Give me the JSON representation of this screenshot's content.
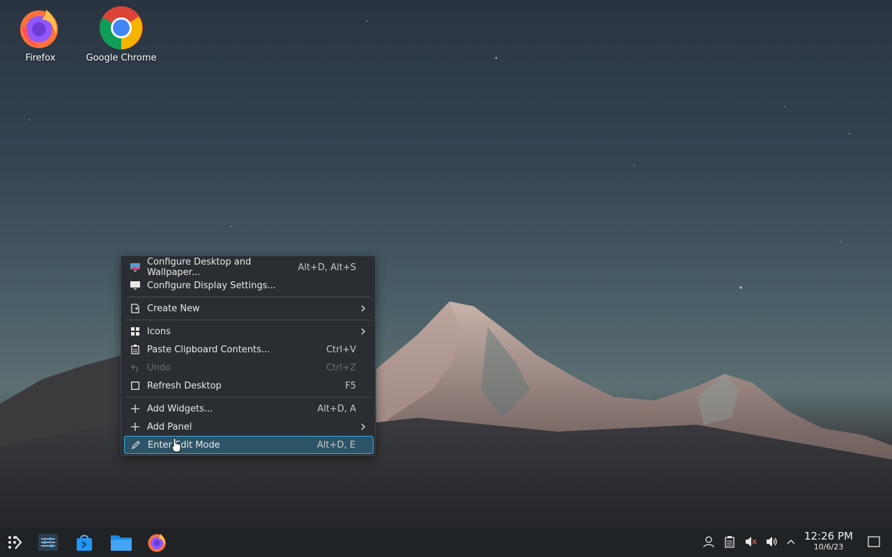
{
  "desktop": {
    "icons": [
      {
        "label": "Firefox",
        "icon": "firefox-icon"
      },
      {
        "label": "Google Chrome",
        "icon": "chrome-icon"
      }
    ]
  },
  "context_menu": {
    "items": [
      {
        "label": "Configure Desktop and Wallpaper...",
        "shortcut": "Alt+D, Alt+S",
        "icon": "wallpaper-settings-icon"
      },
      {
        "label": "Configure Display Settings...",
        "shortcut": "",
        "icon": "display-icon"
      },
      {
        "label": "Create New",
        "shortcut": "",
        "icon": "new-document-icon",
        "submenu": true
      },
      {
        "label": "Icons",
        "shortcut": "",
        "icon": "icons-grid-icon",
        "submenu": true
      },
      {
        "label": "Paste Clipboard Contents...",
        "shortcut": "Ctrl+V",
        "icon": "clipboard-icon"
      },
      {
        "label": "Undo",
        "shortcut": "Ctrl+Z",
        "icon": "undo-icon",
        "disabled": true
      },
      {
        "label": "Refresh Desktop",
        "shortcut": "F5",
        "icon": "refresh-icon"
      },
      {
        "label": "Add Widgets...",
        "shortcut": "Alt+D, A",
        "icon": "plus-icon"
      },
      {
        "label": "Add Panel",
        "shortcut": "",
        "icon": "plus-icon",
        "submenu": true
      },
      {
        "label": "Enter Edit Mode",
        "shortcut": "Alt+D, E",
        "icon": "pencil-icon",
        "highlighted": true
      }
    ]
  },
  "taskbar": {
    "launchers": [
      "application-launcher-icon",
      "settings-icon",
      "discover-store-icon",
      "file-manager-icon",
      "firefox-icon"
    ],
    "tray": [
      "user-icon",
      "clipboard-icon",
      "muted-speaker-icon",
      "volume-icon",
      "chevron-up-icon"
    ],
    "clock": {
      "time": "12:26 PM",
      "date": "10/6/23"
    },
    "show_desktop_icon": "show-desktop-icon"
  },
  "colors": {
    "menu_bg": "#2a2e32",
    "highlight_border": "#3daee9",
    "highlight_bg": "#2d5466",
    "taskbar_bg": "#202326"
  }
}
